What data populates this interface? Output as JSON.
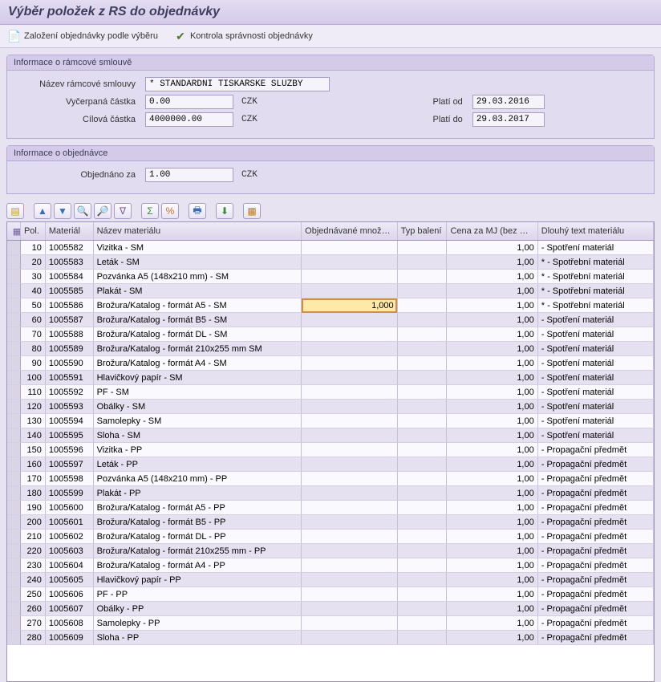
{
  "title": "Výběr položek z RS do objednávky",
  "toolbar_top": {
    "create_order": "Založení objednávky podle výběru",
    "check_order": "Kontrola správnosti objednávky"
  },
  "group_frame": {
    "title": "Informace o rámcové smlouvě",
    "name_label": "Název rámcové smlouvy",
    "name_value": "* STANDARDNÍ TISKAŘSKÉ SLUŽBY",
    "drawn_label": "Vyčerpaná částka",
    "drawn_value": "0.00",
    "drawn_curr": "CZK",
    "target_label": "Cílová částka",
    "target_value": "4000000.00",
    "target_curr": "CZK",
    "valid_from_label": "Platí od",
    "valid_from_value": "29.03.2016",
    "valid_to_label": "Platí do",
    "valid_to_value": "29.03.2017"
  },
  "group_order": {
    "title": "Informace o objednávce",
    "ordered_label": "Objednáno za",
    "ordered_value": "1.00",
    "ordered_curr": "CZK"
  },
  "grid": {
    "columns": {
      "pol": "Pol.",
      "material": "Materiál",
      "nazev": "Název materiálu",
      "mnozstvi": "Objednávané množs…",
      "baleni": "Typ balení",
      "cena": "Cena za MJ (bez DPH)",
      "text": "Dlouhý text materiálu"
    },
    "active_row_index": 4,
    "active_qty": "1,000",
    "rows": [
      {
        "pol": "10",
        "mat": "1005582",
        "nazev": "Vizitka - SM",
        "cena": "1,00",
        "text": "- Spotření materiál"
      },
      {
        "pol": "20",
        "mat": "1005583",
        "nazev": "Leták - SM",
        "cena": "1,00",
        "text": "* - Spotřební materiál"
      },
      {
        "pol": "30",
        "mat": "1005584",
        "nazev": "Pozvánka A5 (148x210 mm) - SM",
        "cena": "1,00",
        "text": "* - Spotřební materiál"
      },
      {
        "pol": "40",
        "mat": "1005585",
        "nazev": "Plakát - SM",
        "cena": "1,00",
        "text": "*  - Spotřební materiál"
      },
      {
        "pol": "50",
        "mat": "1005586",
        "nazev": "Brožura/Katalog - formát A5 - SM",
        "cena": "1,00",
        "text": "*  - Spotřební materiál"
      },
      {
        "pol": "60",
        "mat": "1005587",
        "nazev": "Brožura/Katalog - formát B5 - SM",
        "cena": "1,00",
        "text": "- Spotření materiál"
      },
      {
        "pol": "70",
        "mat": "1005588",
        "nazev": "Brožura/Katalog - formát DL - SM",
        "cena": "1,00",
        "text": "- Spotření materiál"
      },
      {
        "pol": "80",
        "mat": "1005589",
        "nazev": "Brožura/Katalog - formát 210x255 mm SM",
        "cena": "1,00",
        "text": "- Spotření materiál"
      },
      {
        "pol": "90",
        "mat": "1005590",
        "nazev": "Brožura/Katalog - formát A4 - SM",
        "cena": "1,00",
        "text": "- Spotření materiál"
      },
      {
        "pol": "100",
        "mat": "1005591",
        "nazev": "Hlavičkový papír - SM",
        "cena": "1,00",
        "text": "- Spotření materiál"
      },
      {
        "pol": "110",
        "mat": "1005592",
        "nazev": "PF - SM",
        "cena": "1,00",
        "text": "- Spotření materiál"
      },
      {
        "pol": "120",
        "mat": "1005593",
        "nazev": "Obálky - SM",
        "cena": "1,00",
        "text": "- Spotření materiál"
      },
      {
        "pol": "130",
        "mat": "1005594",
        "nazev": "Samolepky - SM",
        "cena": "1,00",
        "text": "- Spotření materiál"
      },
      {
        "pol": "140",
        "mat": "1005595",
        "nazev": "Sloha - SM",
        "cena": "1,00",
        "text": "- Spotření materiál"
      },
      {
        "pol": "150",
        "mat": "1005596",
        "nazev": "Vizitka - PP",
        "cena": "1,00",
        "text": "- Propagační předmět"
      },
      {
        "pol": "160",
        "mat": "1005597",
        "nazev": "Leták - PP",
        "cena": "1,00",
        "text": "- Propagační předmět"
      },
      {
        "pol": "170",
        "mat": "1005598",
        "nazev": "Pozvánka A5 (148x210 mm) - PP",
        "cena": "1,00",
        "text": "- Propagační předmět"
      },
      {
        "pol": "180",
        "mat": "1005599",
        "nazev": "Plakát - PP",
        "cena": "1,00",
        "text": "- Propagační předmět"
      },
      {
        "pol": "190",
        "mat": "1005600",
        "nazev": "Brožura/Katalog - formát A5 - PP",
        "cena": "1,00",
        "text": "- Propagační předmět"
      },
      {
        "pol": "200",
        "mat": "1005601",
        "nazev": "Brožura/Katalog - formát B5 - PP",
        "cena": "1,00",
        "text": "- Propagační předmět"
      },
      {
        "pol": "210",
        "mat": "1005602",
        "nazev": "Brožura/Katalog - formát DL - PP",
        "cena": "1,00",
        "text": "- Propagační předmět"
      },
      {
        "pol": "220",
        "mat": "1005603",
        "nazev": "Brožura/Katalog - formát 210x255 mm - PP",
        "cena": "1,00",
        "text": "- Propagační předmět"
      },
      {
        "pol": "230",
        "mat": "1005604",
        "nazev": "Brožura/Katalog - formát A4 - PP",
        "cena": "1,00",
        "text": "- Propagační předmět"
      },
      {
        "pol": "240",
        "mat": "1005605",
        "nazev": "Hlavičkový papír - PP",
        "cena": "1,00",
        "text": "- Propagační předmět"
      },
      {
        "pol": "250",
        "mat": "1005606",
        "nazev": "PF - PP",
        "cena": "1,00",
        "text": "- Propagační předmět"
      },
      {
        "pol": "260",
        "mat": "1005607",
        "nazev": "Obálky - PP",
        "cena": "1,00",
        "text": "- Propagační předmět"
      },
      {
        "pol": "270",
        "mat": "1005608",
        "nazev": "Samolepky - PP",
        "cena": "1,00",
        "text": "- Propagační předmět"
      },
      {
        "pol": "280",
        "mat": "1005609",
        "nazev": "Sloha - PP",
        "cena": "1,00",
        "text": "- Propagační předmět"
      }
    ]
  }
}
